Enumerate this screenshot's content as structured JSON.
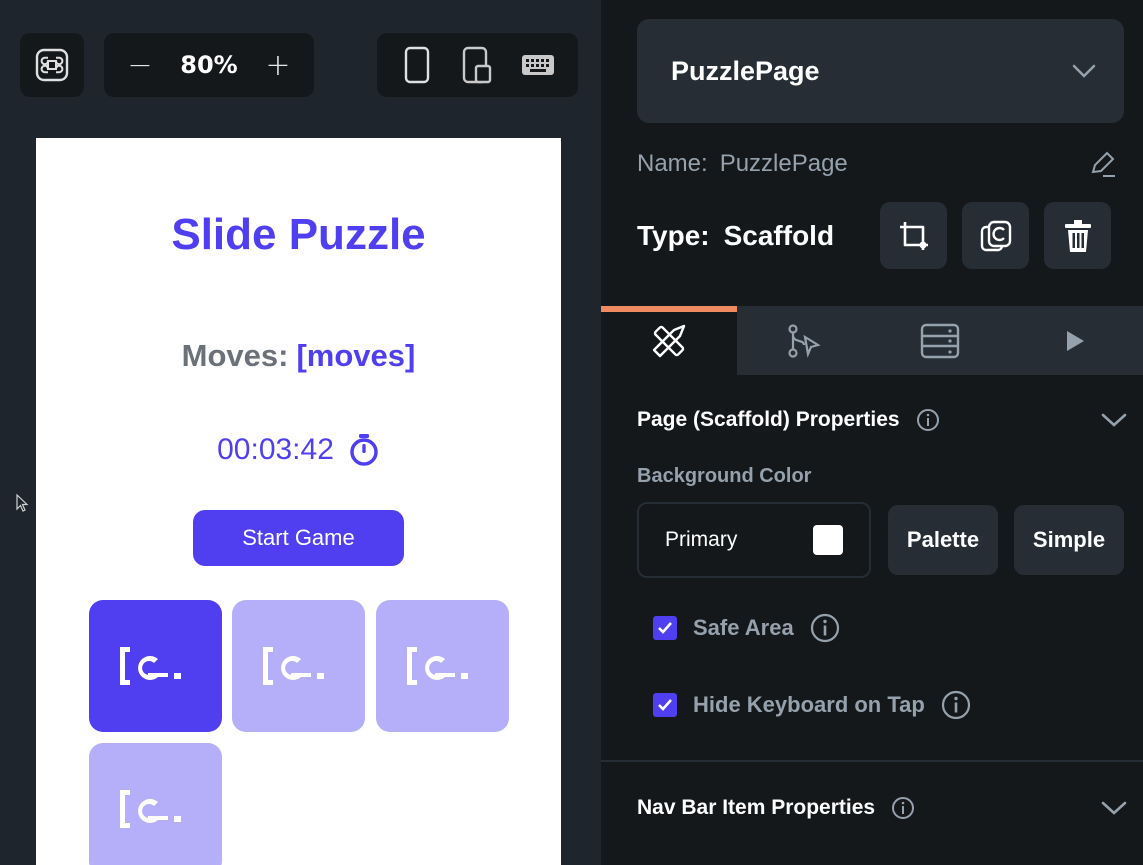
{
  "toolbar": {
    "zoom_value": "80%",
    "zoom_out_label": "−",
    "zoom_in_label": "+"
  },
  "preview": {
    "title": "Slide Puzzle",
    "moves_label": "Moves:",
    "moves_value": "[moves]",
    "timer": "00:03:42",
    "start_button": "Start Game",
    "tiles": [
      {
        "state": "active"
      },
      {
        "state": "light"
      },
      {
        "state": "light"
      },
      {
        "state": "light"
      }
    ],
    "colors": {
      "primary": "#4f3ff0",
      "tile_light": "#b4aff8",
      "moves_label": "#6b7178"
    }
  },
  "panel": {
    "page_selector": "PuzzlePage",
    "name_label": "Name:",
    "name_value": "PuzzlePage",
    "type_label": "Type:",
    "type_value": "Scaffold",
    "tabs": [
      {
        "icon": "ruler-pencil-icon",
        "active": true
      },
      {
        "icon": "workflow-icon",
        "active": false
      },
      {
        "icon": "database-icon",
        "active": false
      },
      {
        "icon": "play-icon",
        "active": false
      }
    ],
    "page_section_title": "Page (Scaffold) Properties",
    "background_color_label": "Background Color",
    "background_color_value": "Primary",
    "palette_button": "Palette",
    "simple_button": "Simple",
    "safe_area_label": "Safe Area",
    "hide_keyboard_label": "Hide Keyboard on Tap",
    "nav_section_title": "Nav Bar Item Properties",
    "colors": {
      "accent_tab": "#ee8b60",
      "panel_bg": "#14181b",
      "card_bg": "#262d34",
      "muted_text": "#95a1ac"
    }
  }
}
